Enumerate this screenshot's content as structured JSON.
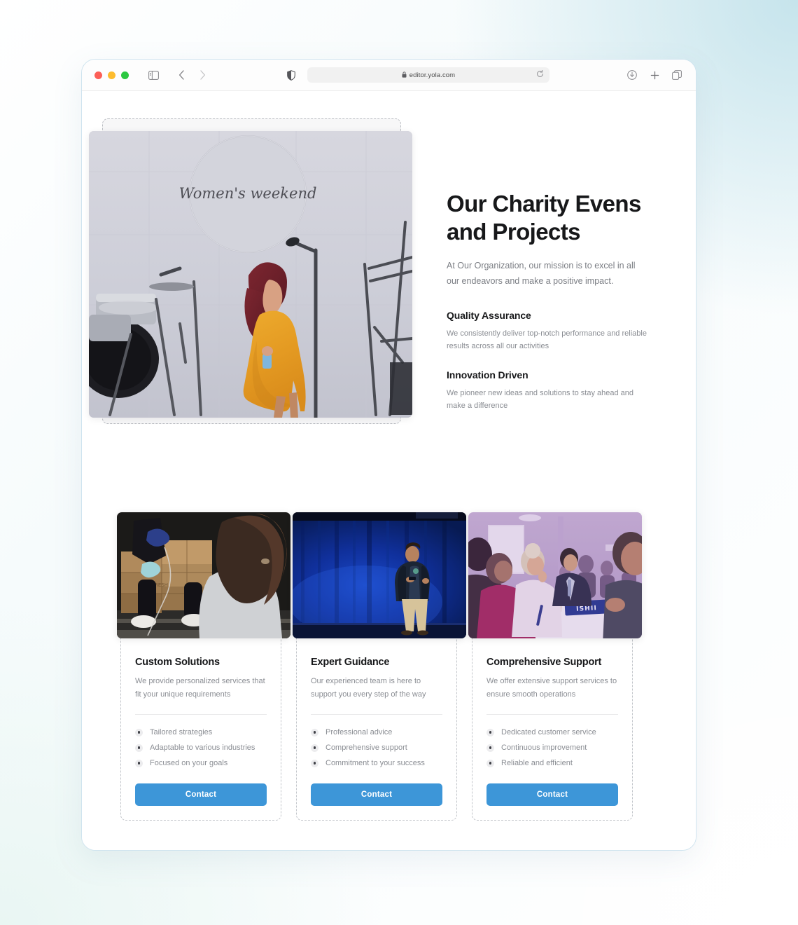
{
  "browser": {
    "url": "editor.yola.com",
    "icons": {
      "traffic_red": "close-window-dot",
      "traffic_yellow": "minimize-window-dot",
      "traffic_green": "maximize-window-dot",
      "sidebar": "sidebar-toggle-icon",
      "back": "chevron-left-icon",
      "forward": "chevron-right-icon",
      "shield": "shield-privacy-icon",
      "lock": "lock-icon",
      "reload": "reload-icon",
      "download": "download-icon",
      "new_tab": "plus-icon",
      "tabs": "tab-overview-icon"
    },
    "colors": {
      "traffic_red": "#fc5f57",
      "traffic_yellow": "#fdbc2e",
      "traffic_green": "#2bc840",
      "window_border": "#cfe4ef"
    }
  },
  "hero": {
    "title": "Our Charity Evens and Projects",
    "subtitle": "At Our Organization, our mission is to excel in all our endeavors and make a positive impact.",
    "image_alt": "Woman in yellow dress speaking into a microphone on stage with a drum kit, under a Women's weekend sign",
    "image_sign_text": "Women's weekend",
    "features": [
      {
        "title": "Quality Assurance",
        "body": "We consistently deliver top-notch performance and reliable results across all our activities"
      },
      {
        "title": "Innovation Driven",
        "body": "We pioneer new ideas and solutions to stay ahead and make a difference"
      }
    ]
  },
  "cards": [
    {
      "title": "Custom Solutions",
      "description": "We provide personalized services that fit your unique requirements",
      "image_alt": "Volunteers carrying stacked cardboard boxes at a food drive",
      "bullets": [
        "Tailored strategies",
        "Adaptable to various industries",
        "Focused on your goals"
      ],
      "button": "Contact"
    },
    {
      "title": "Expert Guidance",
      "description": "Our experienced team is here to support you every step of the way",
      "image_alt": "Speaker presenting on a stage in front of a deep blue curtain",
      "bullets": [
        "Professional advice",
        "Comprehensive support",
        "Commitment to your success"
      ],
      "button": "Contact"
    },
    {
      "title": "Comprehensive Support",
      "description": "We offer extensive support services to ensure smooth operations",
      "image_alt": "Attendees seated around a round table at a conference with an ISHII nameplate",
      "image_nameplate_text": "ISHII",
      "bullets": [
        "Dedicated customer service",
        "Continuous improvement",
        "Reliable and efficient"
      ],
      "button": "Contact"
    }
  ],
  "theme": {
    "accent_blue": "#3d96d8",
    "heading_color": "#17181a",
    "body_text_color": "#8a8d93",
    "dashed_border_color": "#c2c5ca"
  }
}
